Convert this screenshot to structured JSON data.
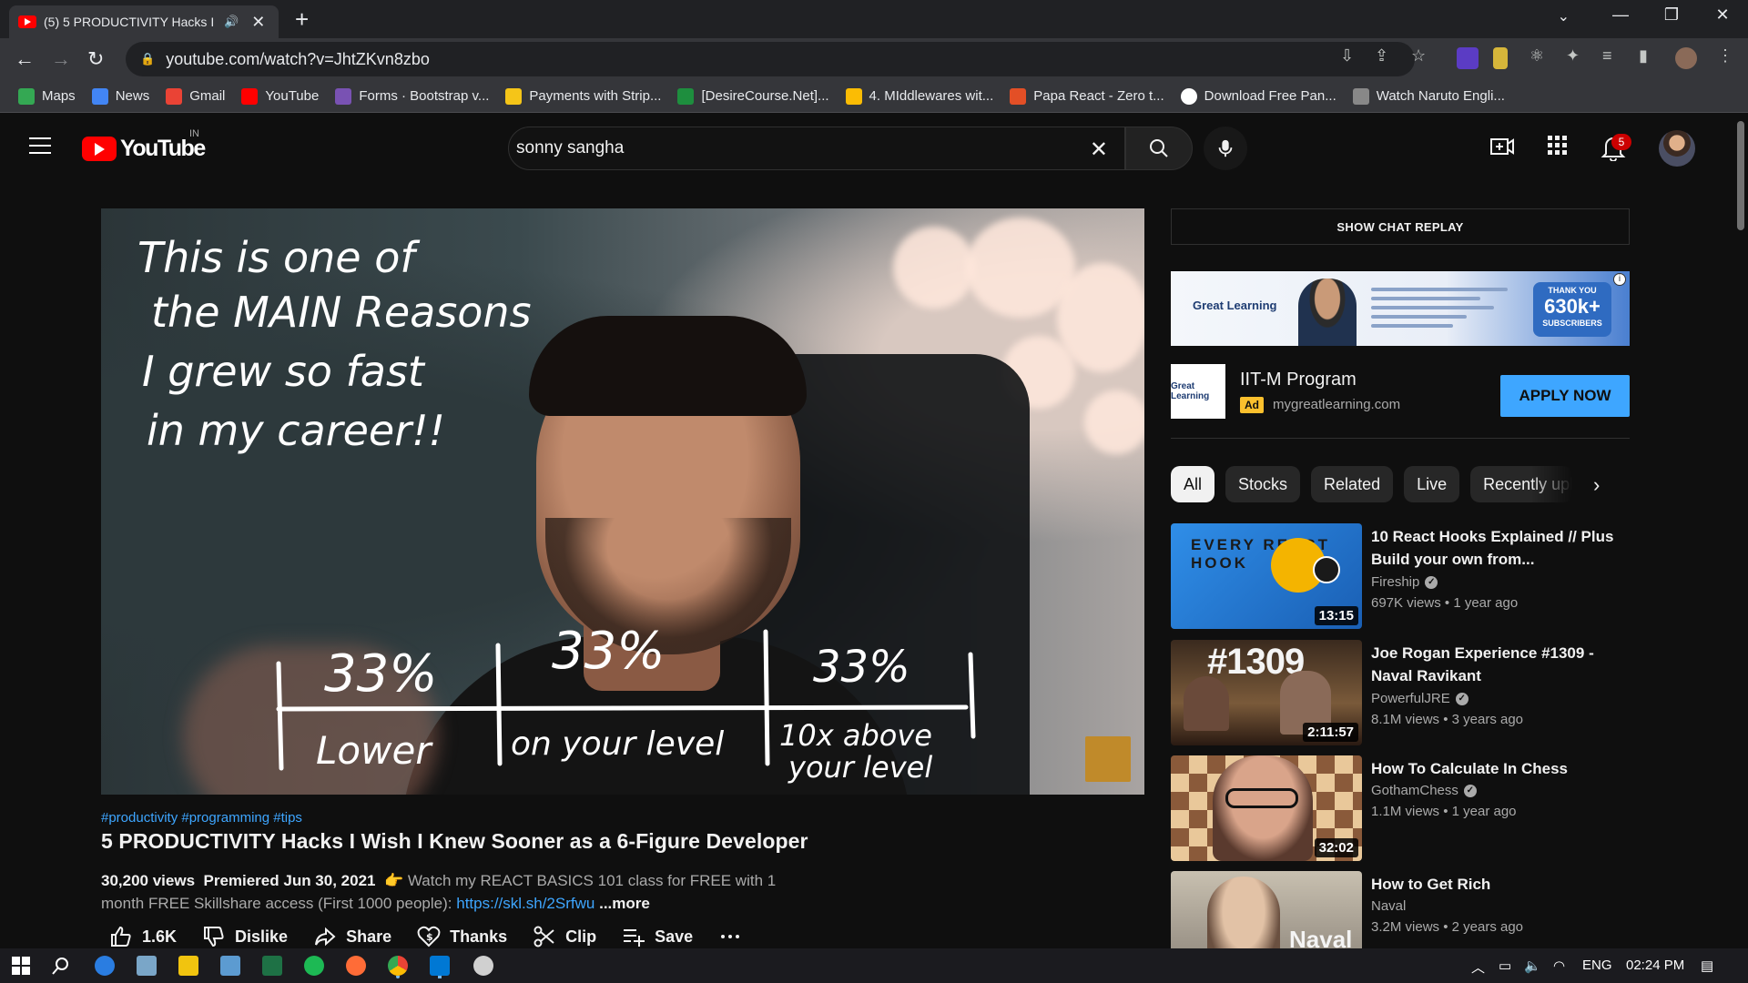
{
  "browser": {
    "tab_title": "(5) 5 PRODUCTIVITY Hacks I",
    "url": "youtube.com/watch?v=JhtZKvn8zbo",
    "bookmarks": [
      {
        "label": "Maps",
        "color": "#34a853"
      },
      {
        "label": "News",
        "color": "#4285f4"
      },
      {
        "label": "Gmail",
        "color": "#ea4335"
      },
      {
        "label": "YouTube",
        "color": "#ff0000"
      },
      {
        "label": "Forms · Bootstrap v...",
        "color": "#7952b3"
      },
      {
        "label": "Payments with Strip...",
        "color": "#f5c518"
      },
      {
        "label": "[DesireCourse.Net]...",
        "color": "#1e8e3e"
      },
      {
        "label": "4. MIddlewares wit...",
        "color": "#fbbc04"
      },
      {
        "label": "Papa React - Zero t...",
        "color": "#e34f26"
      },
      {
        "label": "Download Free Pan...",
        "color": "#ffffff"
      },
      {
        "label": "Watch Naruto Engli...",
        "color": "#888888"
      }
    ]
  },
  "youtube": {
    "logo_text": "YouTube",
    "country_code": "IN",
    "search_value": "sonny sangha",
    "notification_count": "5"
  },
  "video": {
    "overlay_lines": [
      "This is one of",
      "the MAIN Reasons",
      "I grew so fast",
      "in my career!!"
    ],
    "percent_a": "33%",
    "percent_b": "33%",
    "percent_c": "33%",
    "label_a": "Lower",
    "label_b": "on your level",
    "label_c1": "10x above",
    "label_c2": "your level",
    "hashtags": "#productivity #programming #tips",
    "title": "5 PRODUCTIVITY Hacks I Wish I Knew Sooner as a 6-Figure Developer",
    "views": "30,200 views",
    "premiered": "Premiered Jun 30, 2021",
    "desc_emoji": "👉",
    "desc_line1": "Watch my REACT BASICS 101 class for FREE with 1",
    "desc_line2": "month FREE Skillshare access (First 1000 people):",
    "desc_link": "https://skl.sh/2Srfwu",
    "more": "...more",
    "actions": {
      "likes": "1.6K",
      "dislike": "Dislike",
      "share": "Share",
      "thanks": "Thanks",
      "clip": "Clip",
      "save": "Save"
    }
  },
  "sidebar": {
    "chat_replay": "SHOW CHAT REPLAY",
    "ad_banner": {
      "brand": "Great Learning",
      "thank_you": "THANK YOU",
      "subs_count": "630k+",
      "subs_label": "SUBSCRIBERS"
    },
    "ad": {
      "title": "IIT-M Program",
      "tag": "Ad",
      "domain": "mygreatlearning.com",
      "cta": "APPLY NOW",
      "logo": "Great Learning"
    },
    "chips": [
      "All",
      "Stocks",
      "Related",
      "Live",
      "Recently uploaded"
    ],
    "recommendations": [
      {
        "title": "10 React Hooks Explained // Plus Build your own from...",
        "channel": "Fireship",
        "verified": true,
        "views": "697K views",
        "age": "1 year ago",
        "duration": "13:15",
        "thumb_text": "EVERY REACT HOOK"
      },
      {
        "title": "Joe Rogan Experience #1309 - Naval Ravikant",
        "channel": "PowerfulJRE",
        "verified": true,
        "views": "8.1M views",
        "age": "3 years ago",
        "duration": "2:11:57",
        "thumb_text": "#1309"
      },
      {
        "title": "How To Calculate In Chess",
        "channel": "GothamChess",
        "verified": true,
        "views": "1.1M views",
        "age": "1 year ago",
        "duration": "32:02",
        "thumb_text": ""
      },
      {
        "title": "How to Get Rich",
        "channel": "Naval",
        "verified": false,
        "views": "3.2M views",
        "age": "2 years ago",
        "duration": "",
        "thumb_text": "Naval"
      }
    ]
  },
  "taskbar": {
    "lang": "ENG",
    "time": "02:24 PM"
  }
}
